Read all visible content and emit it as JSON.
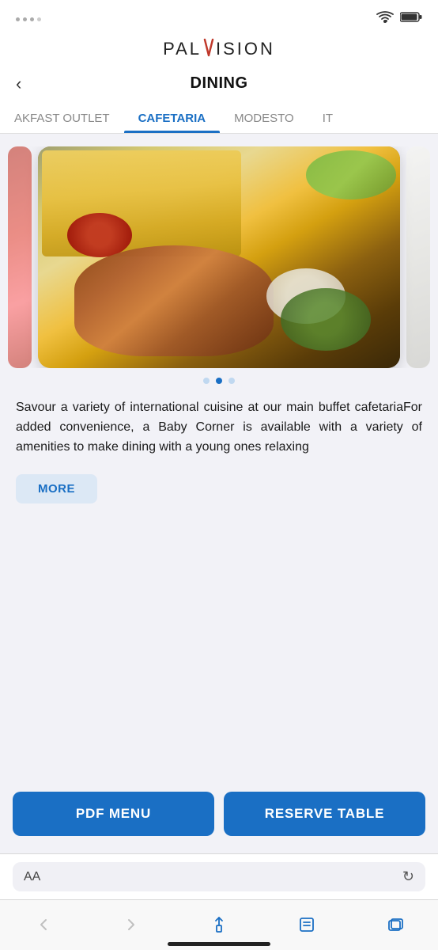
{
  "statusBar": {
    "dots": 4,
    "wifi": "wifi-icon",
    "battery": "battery-icon"
  },
  "logo": {
    "text": "PALVISION",
    "accent_letter": "V"
  },
  "header": {
    "back_label": "‹",
    "title": "DINING"
  },
  "tabs": [
    {
      "id": "breakfast",
      "label": "AKFAST OUTLET",
      "active": false
    },
    {
      "id": "cafetaria",
      "label": "CAFETARIA",
      "active": true
    },
    {
      "id": "modesto",
      "label": "MODESTO",
      "active": false
    },
    {
      "id": "it",
      "label": "IT",
      "active": false
    }
  ],
  "carousel": {
    "dots": [
      {
        "active": false
      },
      {
        "active": true
      },
      {
        "active": false
      }
    ]
  },
  "description": "Savour a variety of international cuisine at our main buffet cafetariaFor added convenience, a Baby Corner is available with a variety of amenities to make dining with a young ones relaxing",
  "more_button": "MORE",
  "actions": {
    "pdf_menu": "PDF MENU",
    "reserve_table": "RESERVE TABLE"
  },
  "browserBar": {
    "aa_label": "AA",
    "reload_icon": "↻"
  },
  "browserNav": {
    "back": "‹",
    "forward": "›",
    "share": "share-icon",
    "bookmarks": "bookmarks-icon",
    "tabs": "tabs-icon"
  }
}
